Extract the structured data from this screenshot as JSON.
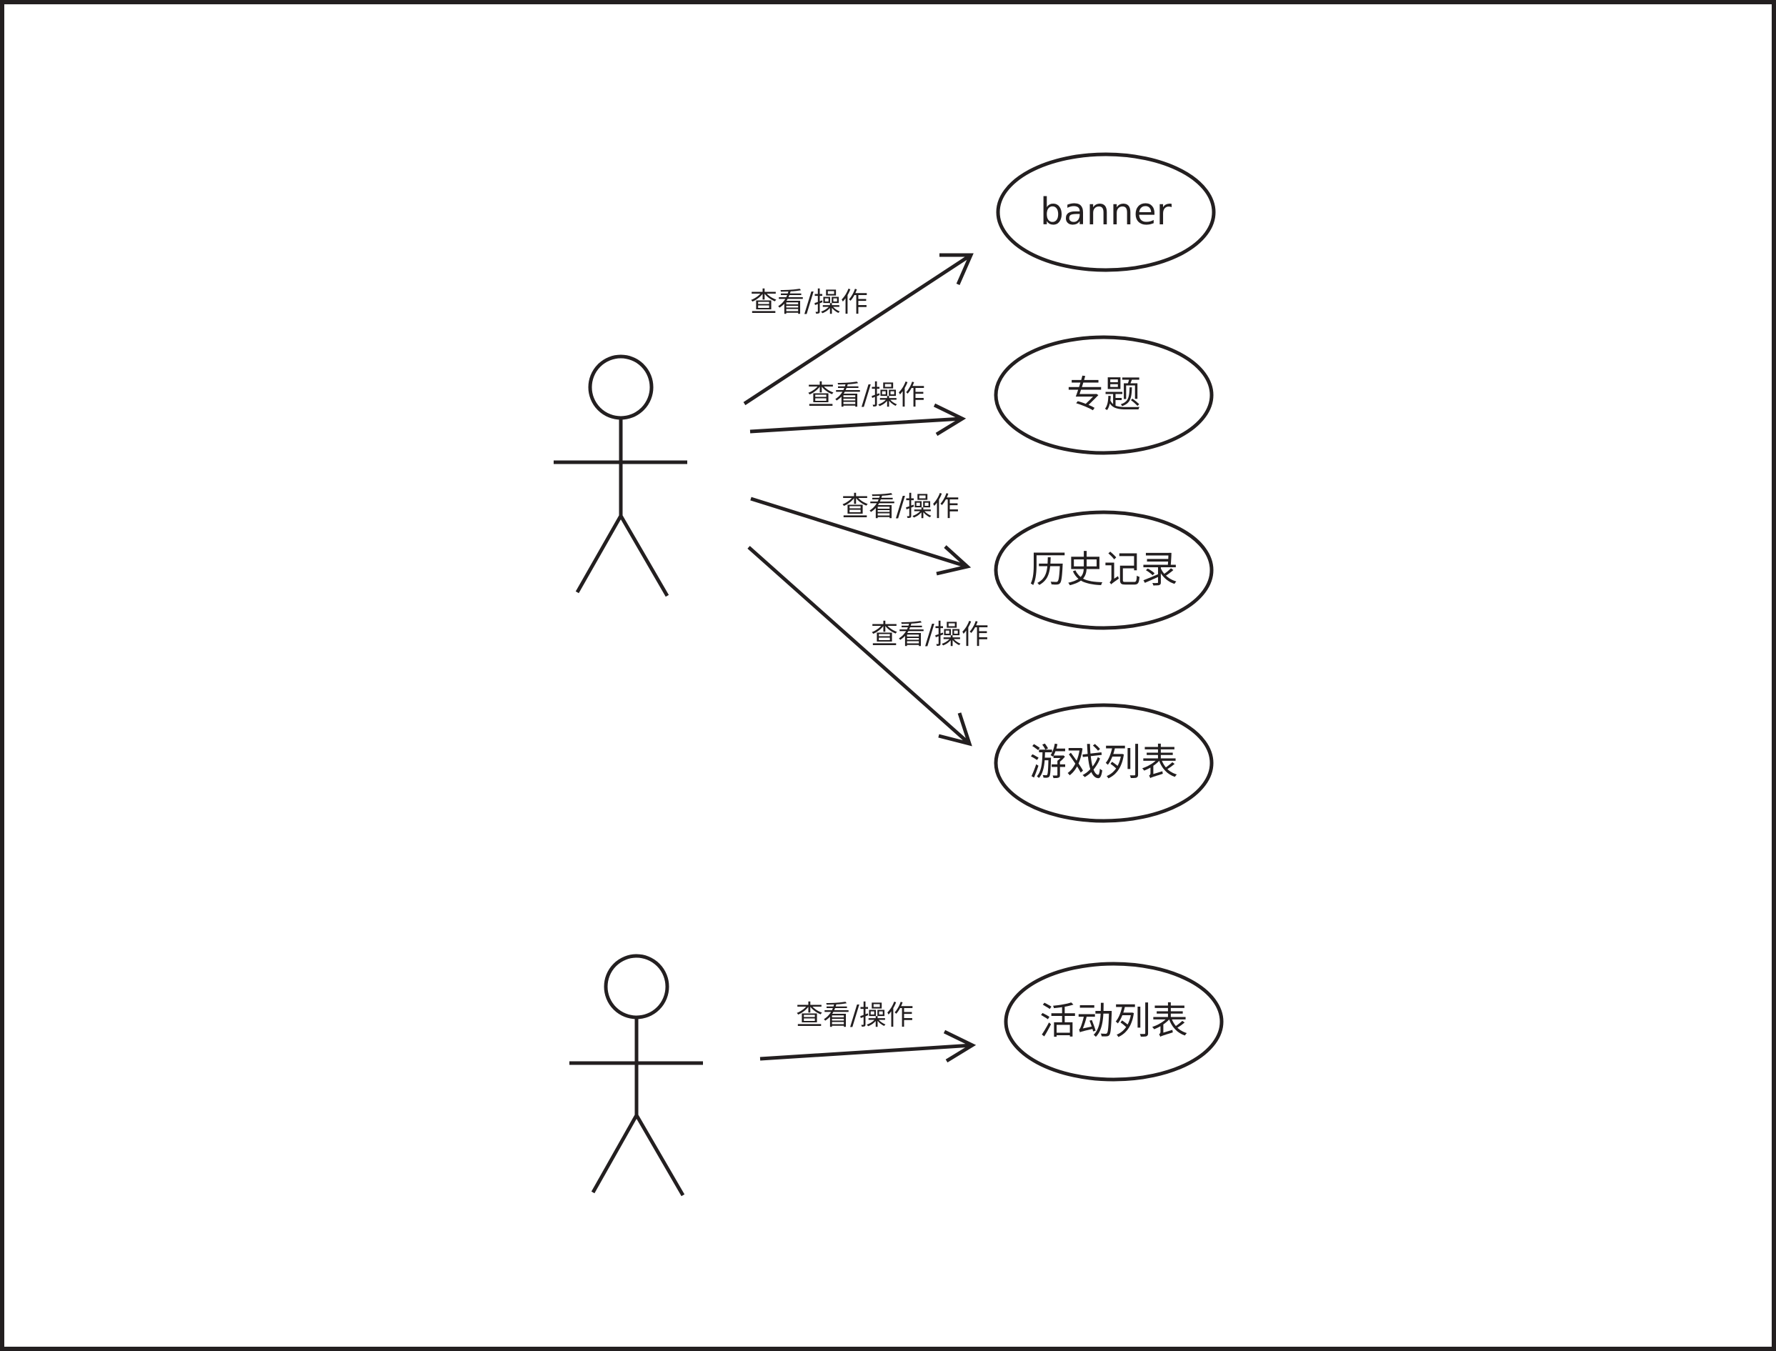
{
  "diagram": {
    "colors": {
      "ink": "#231f20",
      "background": "#ffffff"
    },
    "actors": [
      {
        "id": "actor-1"
      },
      {
        "id": "actor-2"
      }
    ],
    "use_cases": [
      {
        "id": "uc-banner",
        "label": "banner"
      },
      {
        "id": "uc-topic",
        "label": "专题"
      },
      {
        "id": "uc-history",
        "label": "历史记录"
      },
      {
        "id": "uc-games",
        "label": "游戏列表"
      },
      {
        "id": "uc-activities",
        "label": "活动列表"
      }
    ],
    "associations": [
      {
        "from": "actor-1",
        "to": "uc-banner",
        "label": "查看/操作"
      },
      {
        "from": "actor-1",
        "to": "uc-topic",
        "label": "查看/操作"
      },
      {
        "from": "actor-1",
        "to": "uc-history",
        "label": "查看/操作"
      },
      {
        "from": "actor-1",
        "to": "uc-games",
        "label": "查看/操作"
      },
      {
        "from": "actor-2",
        "to": "uc-activities",
        "label": "查看/操作"
      }
    ]
  }
}
